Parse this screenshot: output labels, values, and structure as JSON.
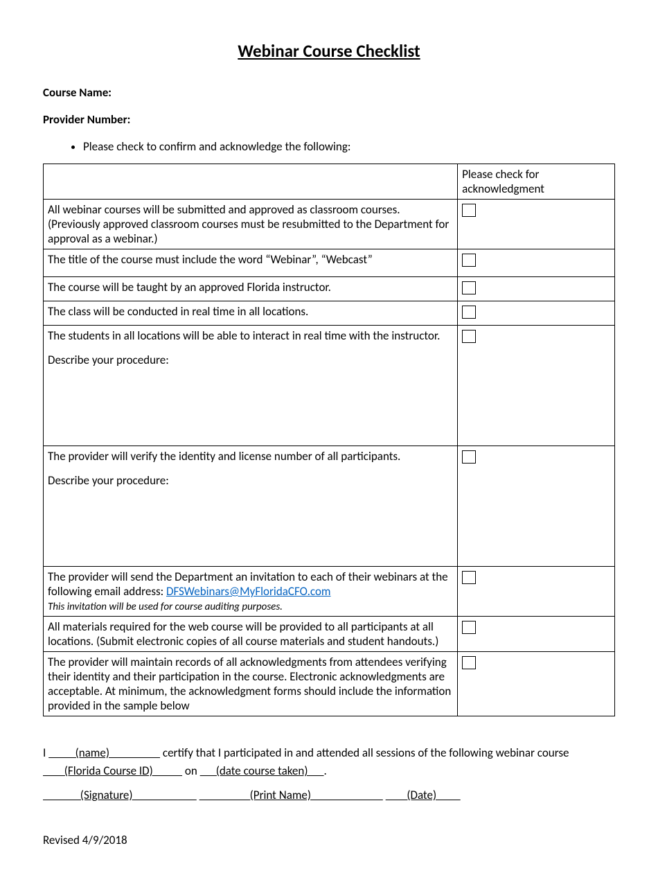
{
  "title": "Webinar Course Checklist",
  "labels": {
    "course_name": "Course Name:",
    "provider_number": "Provider Number:"
  },
  "intro_bullet": "Please check to confirm and acknowledge the following:",
  "table": {
    "ack_header": "Please check for acknowledgment",
    "describe_label": "Describe your procedure:",
    "rows": {
      "r1": "All webinar courses will be submitted and approved as classroom courses. (Previously approved classroom courses must be resubmitted to the Department for approval as a webinar.)",
      "r2": "The title of the course must include the word “Webinar”, “Webcast”",
      "r3": "The course will be taught by an approved Florida instructor.",
      "r4": "The class will be conducted in real time in all locations.",
      "r5": "The students in all locations will be able to interact in real time with the instructor.",
      "r6": "The provider will verify the identity and license number of all participants.",
      "r7_a": "The provider will send the Department an invitation to each of their webinars at the following email address:  ",
      "r7_email": "DFSWebinars@MyFloridaCFO.com",
      "r7_b": "This invitation will be used for course auditing purposes.",
      "r8": "All materials required for the web course will be provided to all participants at all locations. (Submit electronic copies of all course materials and student handouts.)",
      "r9": "The provider will maintain records of all acknowledgments from attendees verifying their identity and their participation in the course. Electronic acknowledgments are acceptable. At minimum, the acknowledgment forms should include the information provided in the sample below"
    }
  },
  "cert": {
    "pre": "I ",
    "name_field": "          (name)                   ",
    "mid1": " certify that I participated in and attended all sessions of the following webinar course",
    "course_id_field": "        (Florida Course ID)           ",
    "mid2": " on ",
    "date_field": "      (date course taken)      ",
    "end": ".",
    "sig": "              (Signature)                        ",
    "gap1": "    ",
    "print": "                   (Print Name)                           ",
    "gap2": "     ",
    "date2": "        (Date)         "
  },
  "revised": "Revised 4/9/2018"
}
